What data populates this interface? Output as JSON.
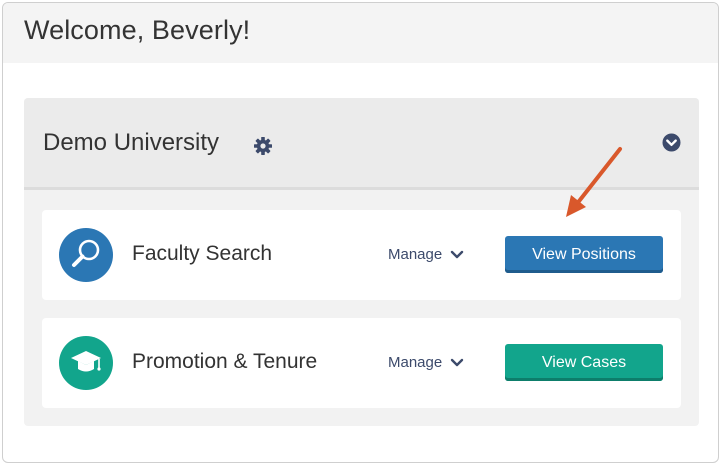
{
  "welcome": {
    "title": "Welcome, Beverly!"
  },
  "organization": {
    "name": "Demo University",
    "settings_icon": "gear-icon",
    "collapse_icon": "chevron-circle-down-icon"
  },
  "modules": [
    {
      "title": "Faculty Search",
      "icon": "magnifier-icon",
      "icon_color": "#2b77b4",
      "manage_label": "Manage",
      "button_label": "View Positions",
      "button_color": "#2b77b4"
    },
    {
      "title": "Promotion & Tenure",
      "icon": "graduation-cap-icon",
      "icon_color": "#12a58c",
      "manage_label": "Manage",
      "button_label": "View Cases",
      "button_color": "#12a58c"
    }
  ],
  "annotation": {
    "arrow_color": "#d9582b"
  }
}
